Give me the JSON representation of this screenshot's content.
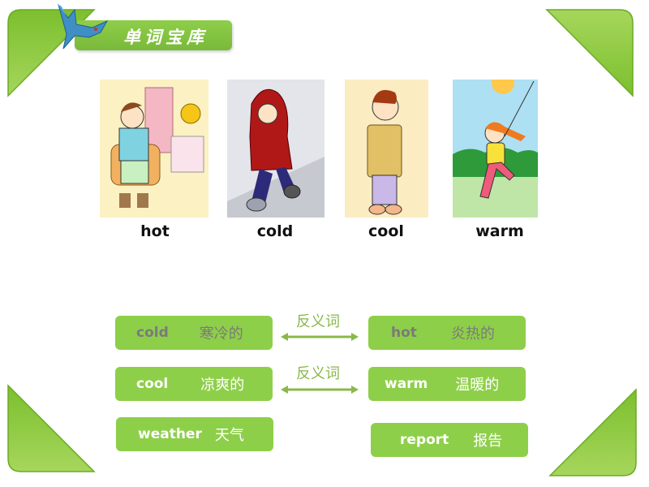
{
  "header": {
    "title": "单词宝库"
  },
  "colors": {
    "accent_green": "#8ecf4a",
    "relation_green": "#8ab84a"
  },
  "pictures": [
    {
      "word": "hot"
    },
    {
      "word": "cold"
    },
    {
      "word": "cool"
    },
    {
      "word": "warm"
    }
  ],
  "vocab_cards": [
    {
      "en": "cold",
      "zh": "寒冷的"
    },
    {
      "en": "hot",
      "zh": "炎热的"
    },
    {
      "en": "cool",
      "zh": "凉爽的"
    },
    {
      "en": "warm",
      "zh": "温暖的"
    },
    {
      "en": "weather",
      "zh": "天气"
    },
    {
      "en": "report",
      "zh": "报告"
    }
  ],
  "relations": [
    {
      "label": "反义词"
    },
    {
      "label": "反义词"
    }
  ]
}
